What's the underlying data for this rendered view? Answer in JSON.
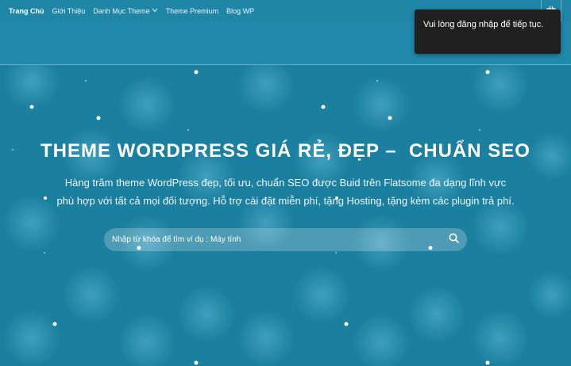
{
  "nav": {
    "items": [
      {
        "label": "Trang Chủ",
        "active": true
      },
      {
        "label": "Giới Thiệu"
      },
      {
        "label": "Danh Mục Theme",
        "has_dropdown": true
      },
      {
        "label": "Theme Premium"
      },
      {
        "label": "Blog WP"
      }
    ]
  },
  "cart": {
    "icon": "shopping-basket-icon"
  },
  "hero": {
    "title": "THEME WORDPRESS GIÁ RẺ, ĐẸP –  CHUẨN SEO",
    "description_line1": "Hàng trăm theme WordPress đẹp, tối ưu, chuẩn SEO được Buid trên Flatsome đa dạng lĩnh vực",
    "description_line2": "phù hợp với tất cả mọi đối tượng. Hỗ trợ cài đặt miễn phí, tặng Hosting, tặng kèm các plugin trả phí."
  },
  "search": {
    "placeholder": "Nhập từ khóa để tìm ví dụ : Máy tính",
    "icon": "search-icon"
  },
  "toast": {
    "message": "Vui lòng đăng nhập để tiếp tục."
  },
  "colors": {
    "topbar": "#1f86a8",
    "hero_bg": "#1b7f9f",
    "toast_bg": "#202020"
  }
}
